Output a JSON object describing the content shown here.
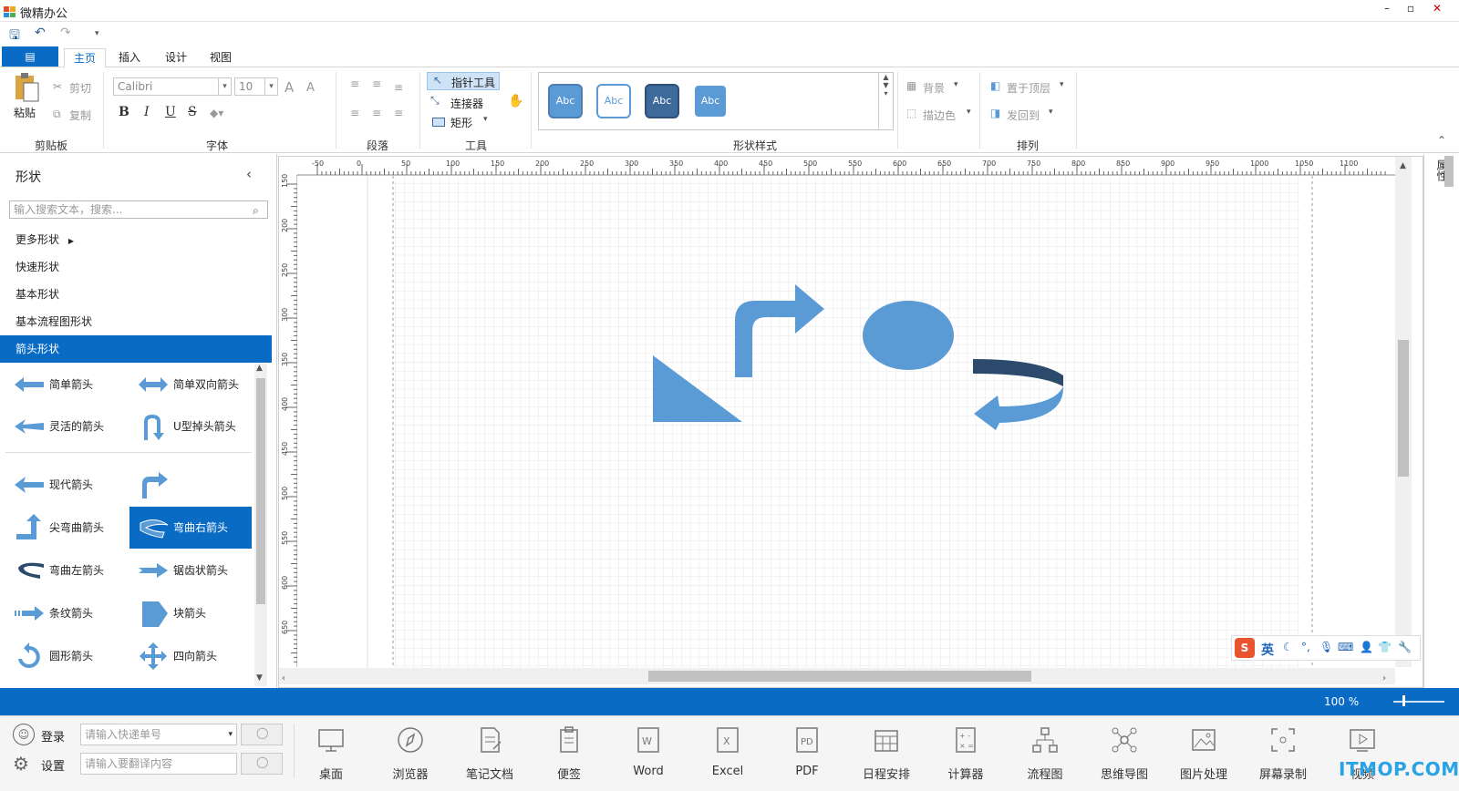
{
  "app": {
    "title": "微精办公"
  },
  "window_controls": {
    "minimize": "–",
    "restore": "▫",
    "close": "✕"
  },
  "tabs": {
    "file": "▤",
    "items": [
      "主页",
      "插入",
      "设计",
      "视图"
    ],
    "active": "主页"
  },
  "ribbon": {
    "clipboard": {
      "paste": "粘贴",
      "cut": "剪切",
      "copy": "复制",
      "label": "剪贴板"
    },
    "font": {
      "family": "Calibri",
      "size": "10",
      "bold": "B",
      "italic": "I",
      "underline": "U",
      "strike": "S",
      "grow": "A",
      "shrink": "A",
      "label": "字体"
    },
    "paragraph": {
      "label": "段落"
    },
    "tools": {
      "pointer": "指针工具",
      "connector": "连接器",
      "rectangle": "矩形",
      "label": "工具"
    },
    "shape_styles": {
      "items": [
        "Abc",
        "Abc",
        "Abc",
        "Abc"
      ],
      "label": "形状样式"
    },
    "bg": {
      "background": "背景",
      "outline": "描边色"
    },
    "arrange": {
      "bring_front": "置于顶层",
      "send_back": "发回到",
      "label": "排列"
    }
  },
  "shapes_panel": {
    "title": "形状",
    "search_placeholder": "输入搜索文本，搜索...",
    "categories": [
      "更多形状",
      "快速形状",
      "基本形状",
      "基本流程图形状",
      "箭头形状"
    ],
    "active_category": "箭头形状",
    "items_top": [
      {
        "label": "简单箭头"
      },
      {
        "label": "简单双向箭头"
      },
      {
        "label": "灵活的箭头"
      },
      {
        "label": "U型掉头箭头"
      }
    ],
    "items_bottom": [
      {
        "label": "现代箭头"
      },
      {
        "label": ""
      },
      {
        "label": "尖弯曲箭头"
      },
      {
        "label": "弯曲右箭头"
      },
      {
        "label": "弯曲左箭头"
      },
      {
        "label": "锯齿状箭头"
      },
      {
        "label": "条纹箭头"
      },
      {
        "label": "块箭头"
      },
      {
        "label": "圆形箭头"
      },
      {
        "label": "四向箭头"
      }
    ]
  },
  "ruler": {
    "h_ticks": [
      "-50",
      "0",
      "50",
      "100",
      "150",
      "200",
      "250",
      "300",
      "350",
      "400",
      "450",
      "500",
      "550",
      "600",
      "650",
      "700",
      "750",
      "800",
      "850",
      "900",
      "950",
      "1000",
      "1050",
      "1100"
    ],
    "v_ticks": [
      "150",
      "200",
      "250",
      "300",
      "350",
      "400",
      "450",
      "500",
      "550",
      "600",
      "650"
    ]
  },
  "properties_tab": "属性",
  "status": {
    "zoom": "100 %"
  },
  "ime": {
    "lang": "英"
  },
  "taskbar": {
    "login": "登录",
    "settings": "设置",
    "express_placeholder": "请输入快递单号",
    "translate_placeholder": "请输入要翻译内容",
    "apps": [
      "桌面",
      "浏览器",
      "笔记文档",
      "便签",
      "Word",
      "Excel",
      "PDF",
      "日程安排",
      "计算器",
      "流程图",
      "思维导图",
      "图片处理",
      "屏幕录制",
      "视频"
    ],
    "watermark": "ITMOP.COM"
  },
  "colors": {
    "accent": "#0a6bc5",
    "shape_fill": "#5b9bd5",
    "shape_dark": "#2c4a6b"
  }
}
